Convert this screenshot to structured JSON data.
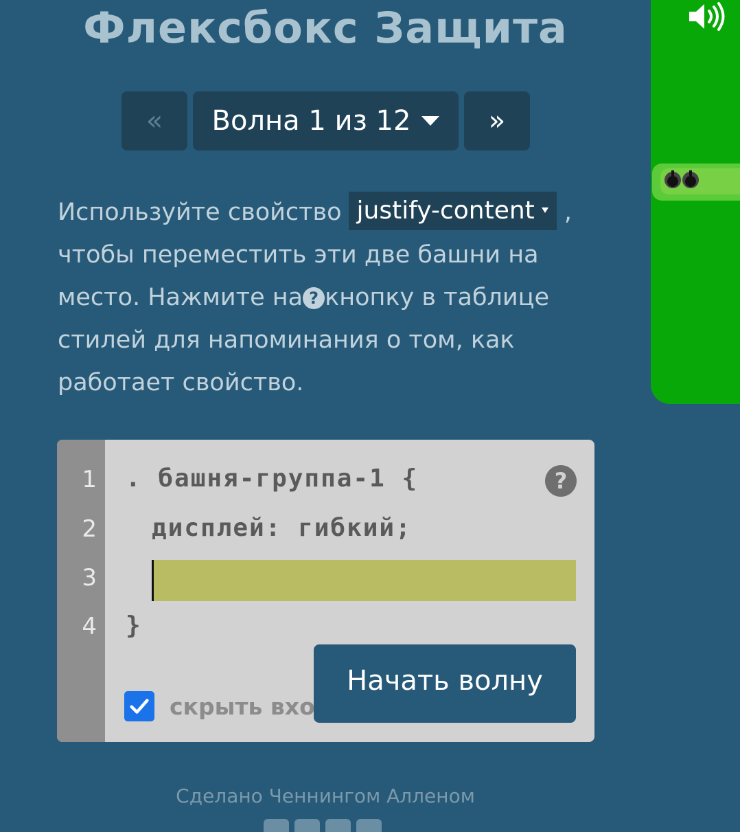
{
  "header": {
    "title": "Флексбокс Защита"
  },
  "nav": {
    "prev_label": "«",
    "level_label": "Волна 1 из 12",
    "next_label": "»"
  },
  "instructions": {
    "part1": "Используйте свойство",
    "property": "justify-content",
    "part2": ", чтобы переместить эти две башни на место. Нажмите на",
    "help_glyph": "?",
    "part3": "кнопку в таблице стилей для напоминания о том, как работает свойство."
  },
  "editor": {
    "line_numbers": [
      "1",
      "2",
      "3",
      "4"
    ],
    "line1": ". башня-группа-1 {",
    "line2": "дисплей: гибкий;",
    "line3_value": "",
    "line4": "}",
    "help_icon": "?",
    "hide_label": "скрыть вход",
    "start_button": "Начать волну",
    "hide_checked": true
  },
  "footer": {
    "credit": "Сделано Ченнингом Алленом"
  },
  "colors": {
    "background": "#275a78",
    "nav_button": "#1f4257",
    "board_green": "#08a808",
    "input_highlight": "#b9bc63",
    "checkbox_blue": "#1a73e8"
  },
  "icons": [
    "sound-icon",
    "help-icon",
    "checkmark-icon",
    "facebook-icon",
    "twitter-icon",
    "linkedin-icon",
    "github-icon"
  ]
}
